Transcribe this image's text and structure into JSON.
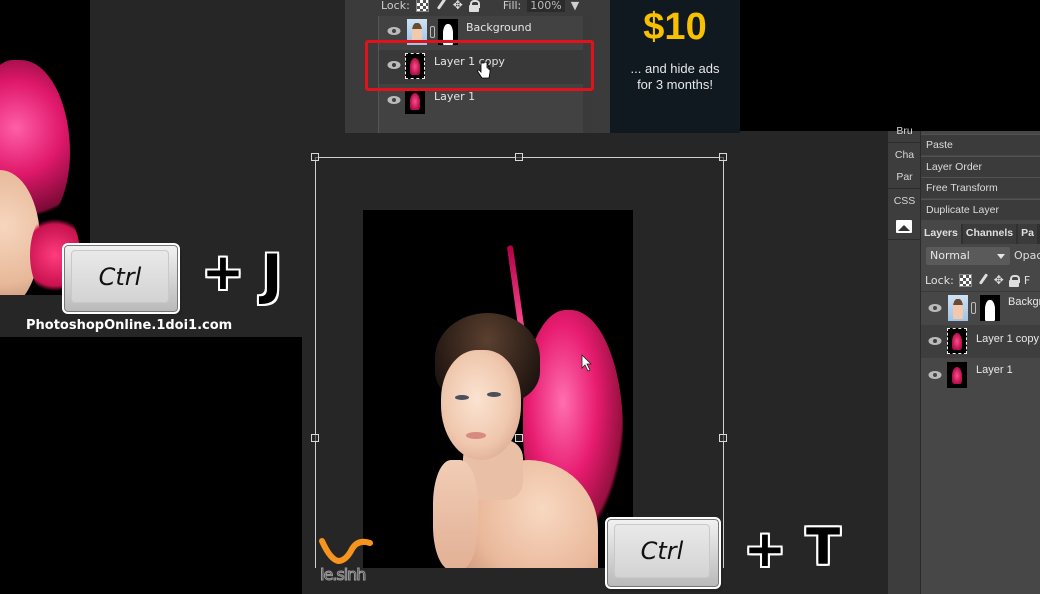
{
  "top_layers_panel": {
    "lock_label": "Lock:",
    "fill_label": "Fill:",
    "fill_value": "100%",
    "layers": [
      {
        "name": "Background",
        "visible": true,
        "thumb": "portrait",
        "has_mask": true,
        "selected": false
      },
      {
        "name": "Layer 1 copy",
        "visible": true,
        "thumb": "ink",
        "has_mask": false,
        "selected": true,
        "highlighted": true
      },
      {
        "name": "Layer 1",
        "visible": true,
        "thumb": "ink",
        "has_mask": false,
        "selected": false
      }
    ],
    "highlight_color": "#e0121a"
  },
  "promo": {
    "price": "$10",
    "line1": "... and hide ads",
    "line2": "for 3 months!",
    "price_color": "#f7c000"
  },
  "shortcuts": [
    {
      "modifier": "Ctrl",
      "plus": "+",
      "key": "J"
    },
    {
      "modifier": "Ctrl",
      "plus": "+",
      "key": "T"
    }
  ],
  "watermark": "PhotoshopOnline.1doi1.com",
  "logo": {
    "text": "le.sinh",
    "color": "#f7941d"
  },
  "side_tabs": [
    "Bru",
    "Cha",
    "Par",
    "CSS"
  ],
  "side_tab_icon": "image-icon",
  "edit_menu": [
    "Paste",
    "Layer Order",
    "Free Transform",
    "Duplicate Layer"
  ],
  "right_panel": {
    "tabs": [
      "Layers",
      "Channels",
      "Pa"
    ],
    "active_tab": "Layers",
    "blend_mode": "Normal",
    "opacity_label": "Opac",
    "lock_label": "Lock:",
    "fill_label": "F",
    "layers": [
      {
        "name": "Backgr",
        "visible": true,
        "thumb": "portrait",
        "has_mask": true,
        "selected": false
      },
      {
        "name": "Layer 1 copy",
        "visible": true,
        "thumb": "ink",
        "has_mask": false,
        "selected": true
      },
      {
        "name": "Layer 1",
        "visible": true,
        "thumb": "ink",
        "has_mask": false,
        "selected": false
      }
    ]
  },
  "canvas": {
    "transform_active": true,
    "document": "portrait-with-pink-ink"
  }
}
